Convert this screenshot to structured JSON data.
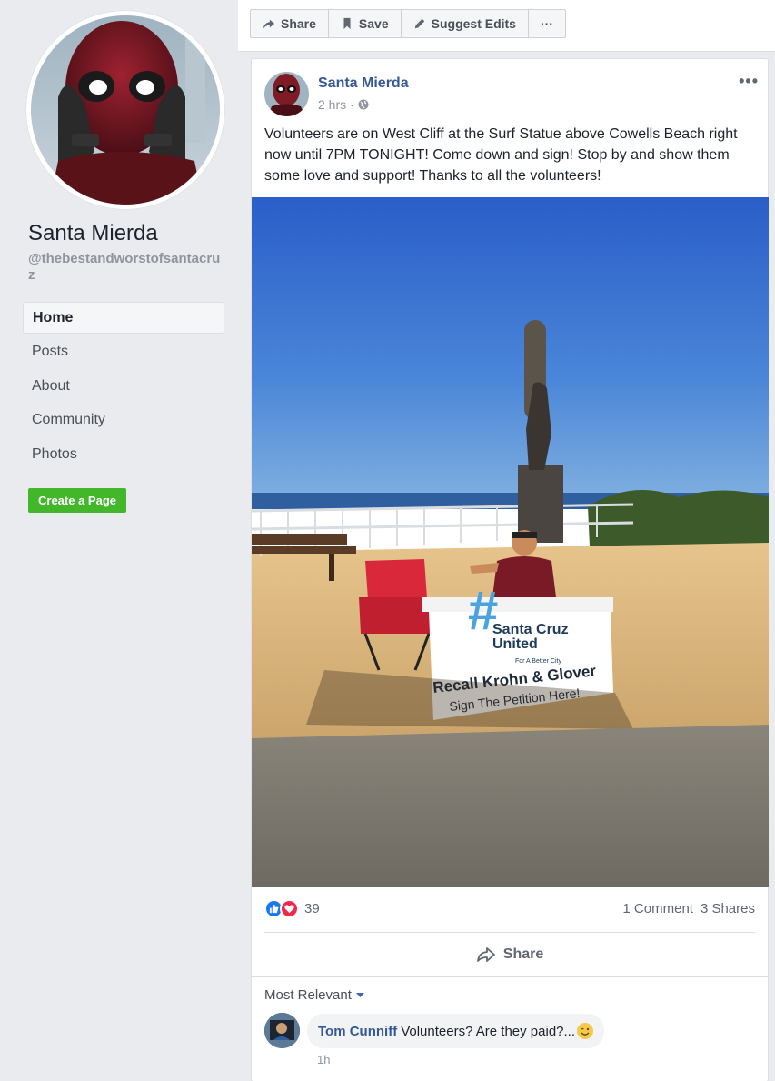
{
  "sidebar": {
    "page_name": "Santa Mierda",
    "handle": "@thebestandworstofsantacruz",
    "nav": [
      {
        "label": "Home",
        "active": true
      },
      {
        "label": "Posts"
      },
      {
        "label": "About"
      },
      {
        "label": "Community"
      },
      {
        "label": "Photos"
      }
    ],
    "create_page": "Create a Page"
  },
  "topbar": {
    "share": "Share",
    "save": "Save",
    "suggest_edits": "Suggest Edits",
    "more": "···"
  },
  "post": {
    "author": "Santa Mierda",
    "time": "2 hrs ·",
    "more": "•••",
    "text": "Volunteers are on West Cliff at the Surf Statue above Cowells Beach right now until 7PM TONIGHT! Come down and sign! Stop by and show them some love and support! Thanks to all the volunteers!",
    "photo": {
      "banner_line1": "Santa Cruz",
      "banner_line2": "United",
      "banner_tagline": "For A Better City",
      "banner_recall": "Recall Krohn & Glover",
      "banner_sign": "Sign The Petition Here!"
    },
    "reaction_count": "39",
    "comments_count": "1 Comment",
    "shares_count": "3 Shares",
    "share_action": "Share",
    "sort_label": "Most Relevant"
  },
  "comment": {
    "author": "Tom Cunniff",
    "text": "Volunteers? Are they paid?...",
    "time": "1h"
  },
  "colors": {
    "link_blue": "#365899",
    "green_button": "#42b72a",
    "like_blue": "#1877f2",
    "love_red": "#f0284a"
  }
}
